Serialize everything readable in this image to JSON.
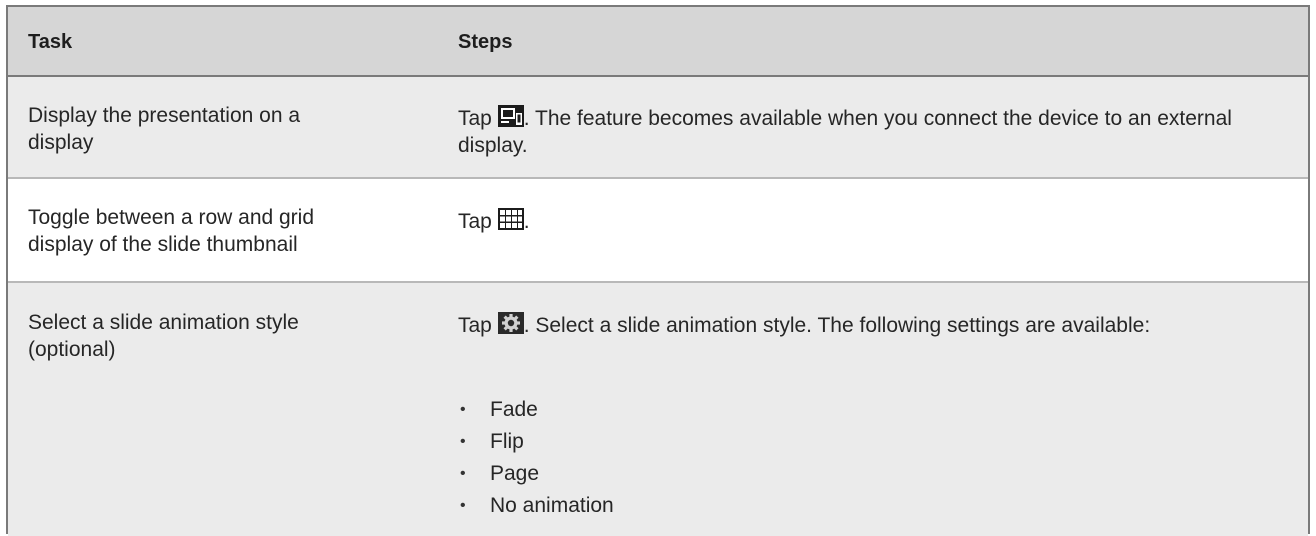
{
  "table": {
    "headers": {
      "task": "Task",
      "steps": "Steps"
    },
    "rows": [
      {
        "task": "Display the presentation on a display",
        "steps_prefix": "Tap",
        "icon": "external-display-icon",
        "steps_suffix": ". The feature becomes available when you connect the device to an external display."
      },
      {
        "task": "Toggle between a row and grid display of the slide thumbnail",
        "steps_prefix": "Tap",
        "icon": "grid-view-icon",
        "steps_suffix": "."
      },
      {
        "task": "Select a slide animation style (optional)",
        "steps_prefix": "Tap",
        "icon": "settings-gear-icon",
        "steps_suffix": ". Select a slide animation style. The following settings are available:",
        "options": [
          "Fade",
          "Flip",
          "Page",
          "No animation"
        ]
      }
    ]
  },
  "colors": {
    "header_bg": "#d6d6d6",
    "row_alt_bg": "#ebebeb",
    "border": "#7a7a7a"
  }
}
